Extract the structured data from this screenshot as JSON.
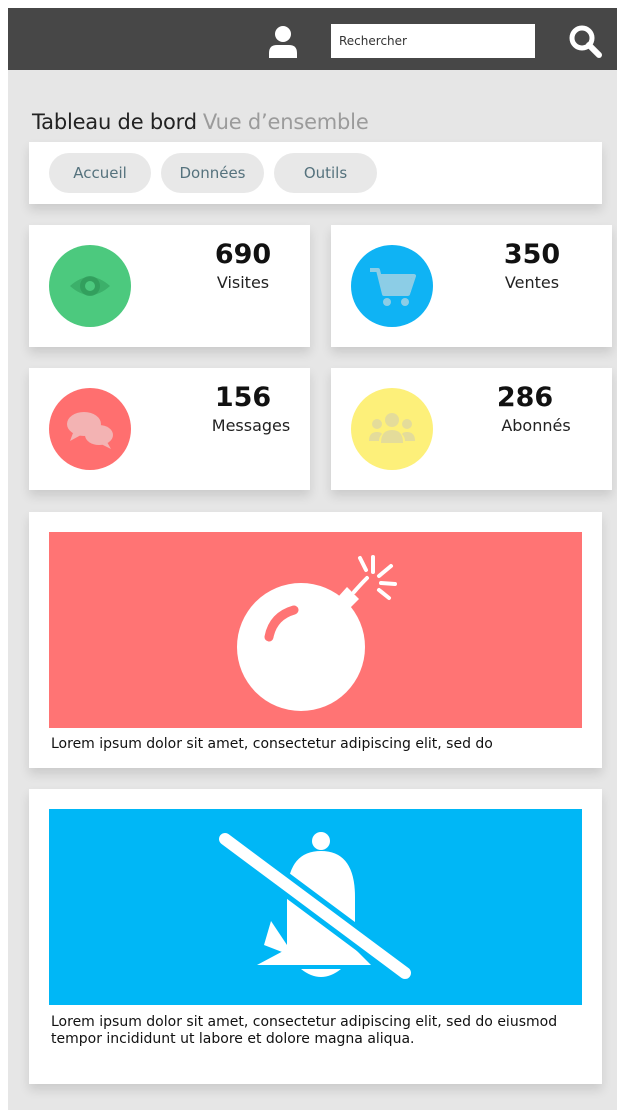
{
  "header": {
    "search_placeholder": "Rechercher",
    "icons": [
      "user-icon",
      "search-icon"
    ]
  },
  "page": {
    "title": "Tableau de bord",
    "subtitle": "Vue d’ensemble"
  },
  "tabs": [
    {
      "label": "Accueil"
    },
    {
      "label": "Données"
    },
    {
      "label": "Outils"
    }
  ],
  "stats": [
    {
      "value": "690",
      "label": "Visites",
      "icon": "eye-icon",
      "color": "#4cc97e"
    },
    {
      "value": "350",
      "label": "Ventes",
      "icon": "cart-icon",
      "color": "#0fb3f4"
    },
    {
      "value": "156",
      "label": "Messages",
      "icon": "chat-bubbles-icon",
      "color": "#ff6f6f"
    },
    {
      "value": "286",
      "label": "Abonnés",
      "icon": "users-group-icon",
      "color": "#fdf07a"
    }
  ],
  "media": [
    {
      "icon": "bomb-icon",
      "color": "#ff7474",
      "caption": "Lorem ipsum dolor sit amet, consectetur adipiscing elit, sed do"
    },
    {
      "icon": "bell-slash-icon",
      "color": "#00b7f6",
      "caption": "Lorem ipsum dolor sit amet, consectetur adipiscing elit, sed do eiusmod tempor incididunt ut labore et dolore magna aliqua."
    }
  ]
}
